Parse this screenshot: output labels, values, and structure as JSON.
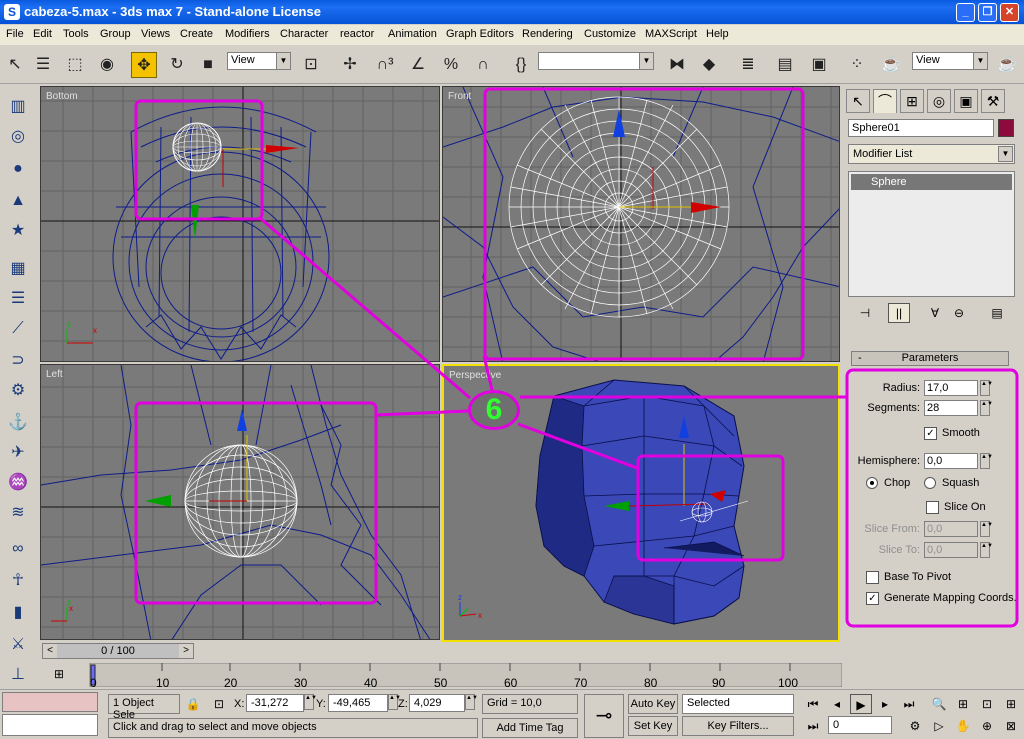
{
  "window": {
    "title": "cabeza-5.max - 3ds max 7 - Stand-alone License",
    "app_icon": "S",
    "buttons": {
      "minimize": "_",
      "maximize": "❐",
      "close": "✕"
    }
  },
  "menu": [
    "File",
    "Edit",
    "Tools",
    "Group",
    "Views",
    "Create",
    "Modifiers",
    "Character",
    "reactor",
    "Animation",
    "Graph Editors",
    "Rendering",
    "Customize",
    "MAXScript",
    "Help"
  ],
  "toolbar": {
    "ref_coord": "View",
    "view2": "View",
    "named_selection": "",
    "icons": [
      "select-pointer-icon",
      "select-by-name-icon",
      "rect-select-icon",
      "window-crossing-icon",
      "select-move-icon",
      "select-rotate-icon",
      "select-scale-icon",
      "pivot-icon",
      "snap-3d-icon",
      "angle-snap-icon",
      "percent-snap-icon",
      "spinner-snap-icon",
      "mirror-icon",
      "align-icon",
      "layers-icon",
      "curve-editor-icon",
      "schematic-icon",
      "material-editor-icon",
      "render-scene-icon",
      "quick-render-icon"
    ]
  },
  "viewports": {
    "top_left": {
      "label": "Bottom"
    },
    "top_right": {
      "label": "Front"
    },
    "bottom_left": {
      "label": "Left"
    },
    "bottom_right": {
      "label": "Perspective"
    }
  },
  "callout": {
    "number": "6",
    "color": "#e000e0"
  },
  "command_panel": {
    "object_name": "Sphere01",
    "object_color": "#8c0b3c",
    "modifier_list": "Modifier List",
    "stack_item": "Sphere",
    "rollout_title": "Parameters",
    "rollout_toggle": "-",
    "params": {
      "radius_label": "Radius:",
      "radius_value": "17,0",
      "segments_label": "Segments:",
      "segments_value": "28",
      "smooth_label": "Smooth",
      "smooth_checked": true,
      "hemisphere_label": "Hemisphere:",
      "hemisphere_value": "0,0",
      "chop_label": "Chop",
      "squash_label": "Squash",
      "mode": "Chop",
      "slice_on_label": "Slice On",
      "slice_on_checked": false,
      "slice_from_label": "Slice From:",
      "slice_from_value": "0,0",
      "slice_to_label": "Slice To:",
      "slice_to_value": "0,0",
      "base_to_pivot_label": "Base To Pivot",
      "base_to_pivot_checked": false,
      "gen_mapping_label": "Generate Mapping Coords.",
      "gen_mapping_checked": true
    }
  },
  "timeline": {
    "slider": "0 / 100",
    "ticks": [
      "0",
      "10",
      "20",
      "30",
      "40",
      "50",
      "60",
      "70",
      "80",
      "90",
      "100"
    ]
  },
  "status": {
    "selection": "1 Object Sele",
    "x_label": "X:",
    "x_value": "-31,272",
    "y_label": "Y:",
    "y_value": "-49,465",
    "z_label": "Z:",
    "z_value": "4,029",
    "grid": "Grid = 10,0",
    "prompt": "Click and drag to select and move objects",
    "add_time_tag": "Add Time Tag",
    "auto_key": "Auto Key",
    "set_key": "Set Key",
    "key_mode": "Selected",
    "key_filters": "Key Filters...",
    "frame": "0"
  }
}
